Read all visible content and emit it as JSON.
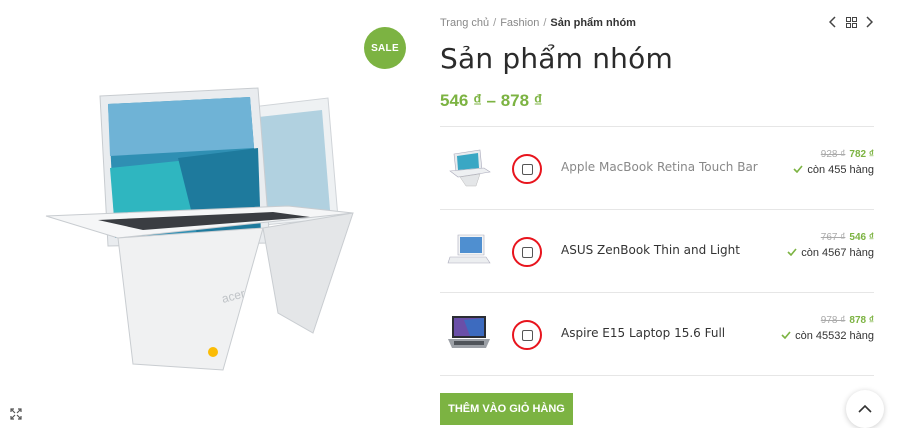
{
  "gallery": {
    "sale_badge": "SALE",
    "main_image": "laptop-convertible-image",
    "zoom_icon": "expand-icon"
  },
  "breadcrumb": {
    "items": [
      "Trang chủ",
      "Fashion"
    ],
    "separator": "/",
    "current": "Sản phẩm nhóm"
  },
  "product_nav": {
    "prev_icon": "chevron-left-icon",
    "grid_icon": "grid-icon",
    "next_icon": "chevron-right-icon"
  },
  "product": {
    "title": "Sản phẩm nhóm",
    "price_range": "546 ₫ – 878 ₫"
  },
  "grouped_items": [
    {
      "name": "Apple MacBook Retina Touch Bar",
      "old_price": "928 ₫",
      "price": "782 ₫",
      "stock": "còn 455 hàng",
      "checked": false
    },
    {
      "name": "ASUS ZenBook Thin and Light",
      "old_price": "767 ₫",
      "price": "546 ₫",
      "stock": "còn 4567 hàng",
      "checked": false
    },
    {
      "name": "Aspire E15 Laptop 15.6 Full",
      "old_price": "978 ₫",
      "price": "878 ₫",
      "stock": "còn 45532 hàng",
      "checked": false
    }
  ],
  "cart": {
    "add_label": "THÊM VÀO GIỎ HÀNG"
  },
  "colors": {
    "accent": "#7cb342",
    "highlight_ring": "#e8141d"
  }
}
